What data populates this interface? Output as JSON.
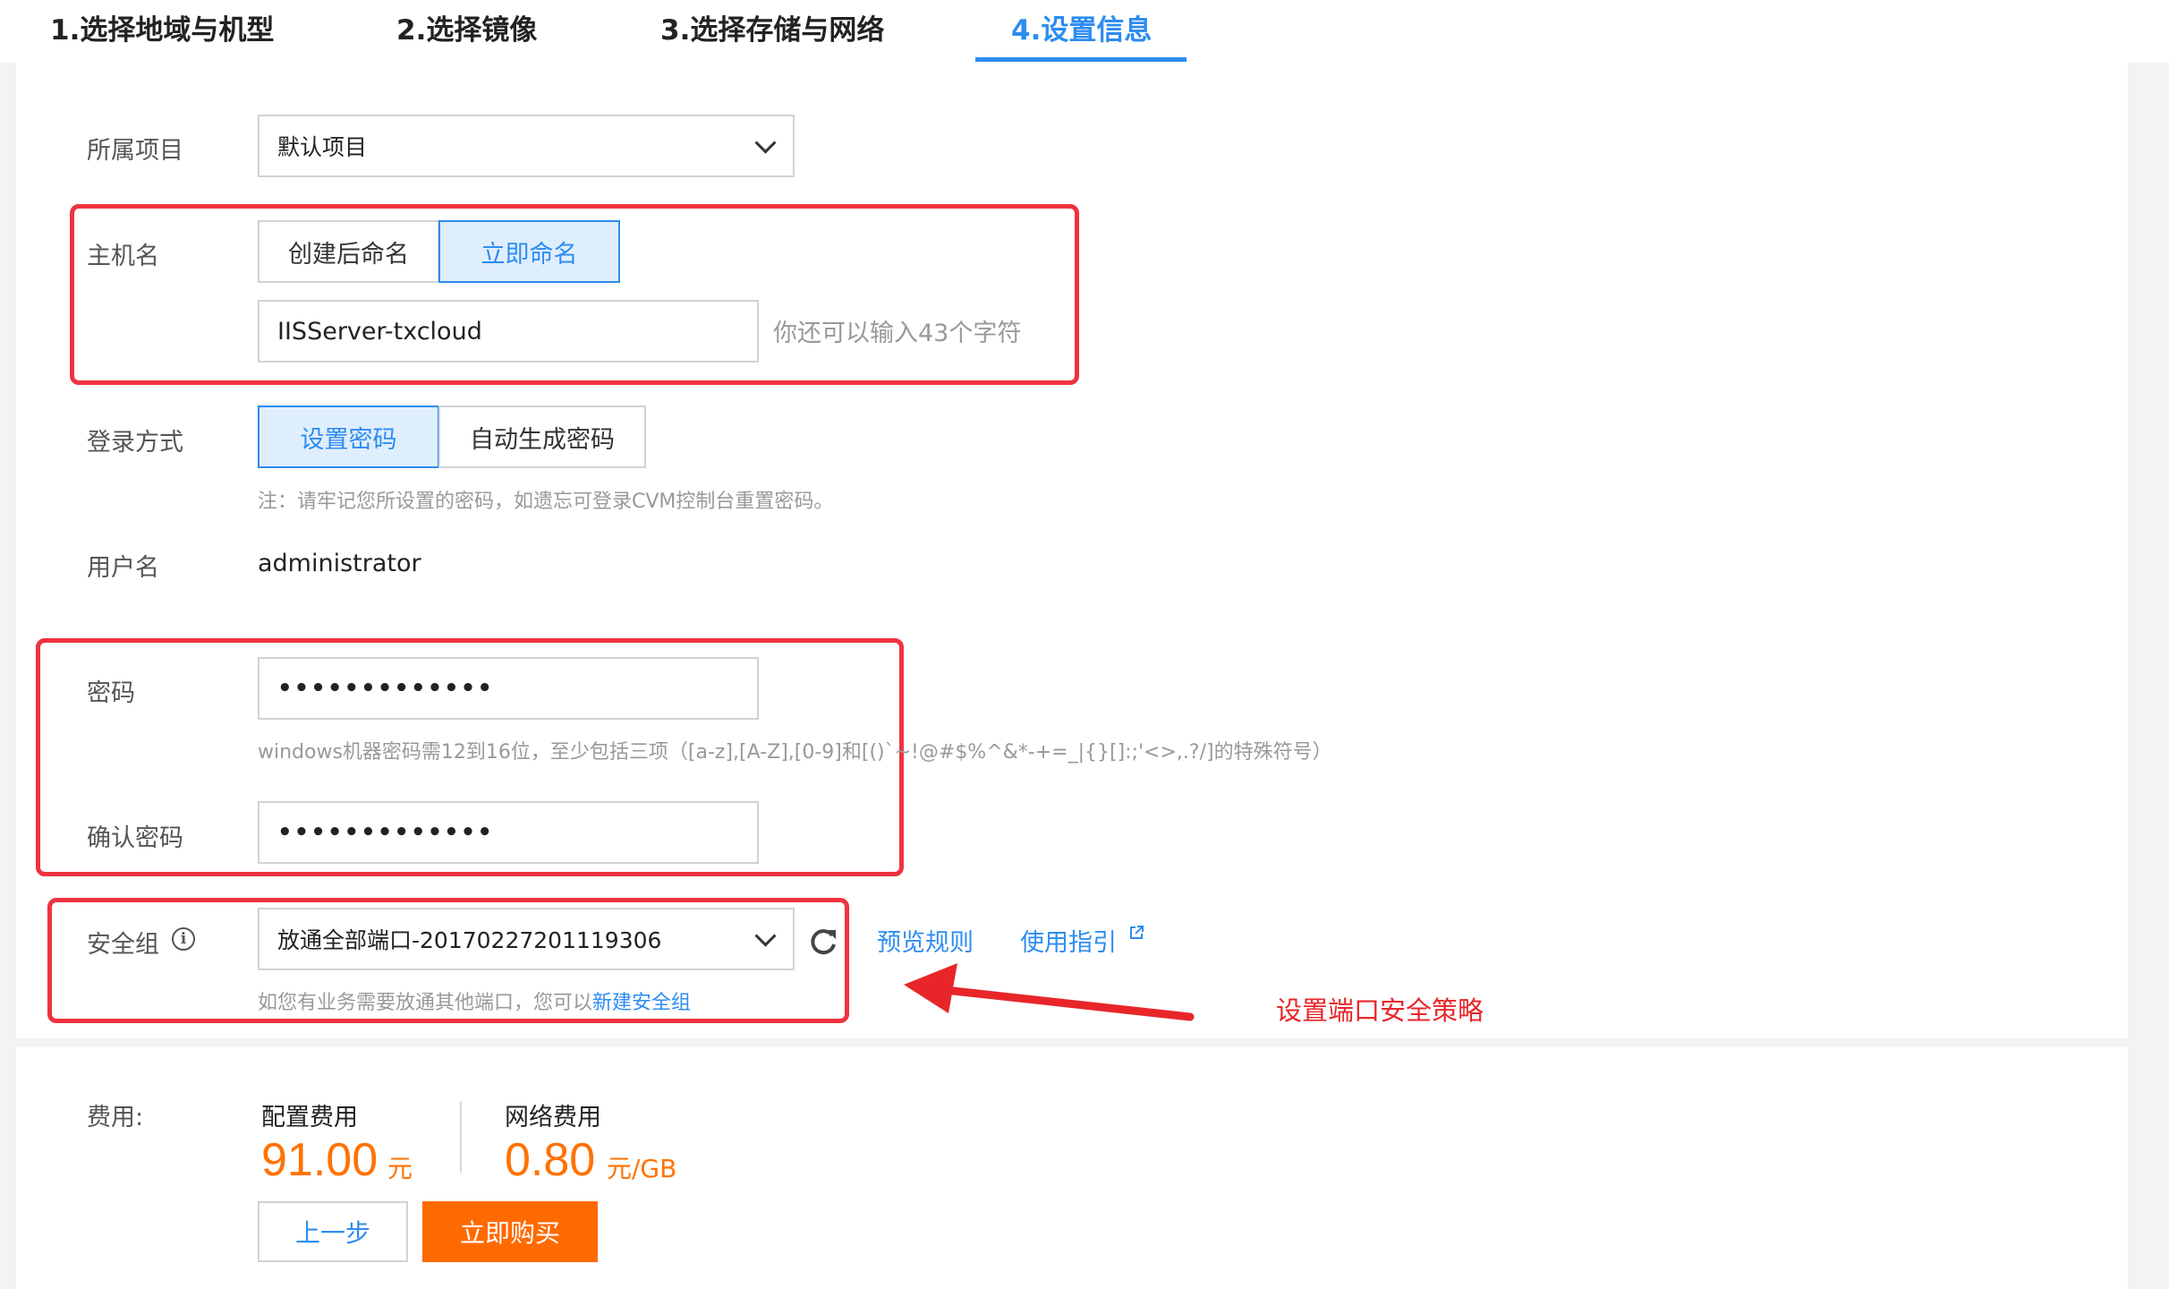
{
  "steps": [
    {
      "label": "1.选择地域与机型",
      "active": false
    },
    {
      "label": "2.选择镜像",
      "active": false
    },
    {
      "label": "3.选择存储与网络",
      "active": false
    },
    {
      "label": "4.设置信息",
      "active": true
    }
  ],
  "project": {
    "label": "所属项目",
    "value": "默认项目"
  },
  "hostname": {
    "label": "主机名",
    "options": [
      "创建后命名",
      "立即命名"
    ],
    "selected": "立即命名",
    "value": "IISServer-txcloud",
    "remaining": "你还可以输入43个字符"
  },
  "login": {
    "label": "登录方式",
    "options": [
      "设置密码",
      "自动生成密码"
    ],
    "selected": "设置密码",
    "note": "注：请牢记您所设置的密码，如遗忘可登录CVM控制台重置密码。"
  },
  "username": {
    "label": "用户名",
    "value": "administrator"
  },
  "password": {
    "label": "密码",
    "value": "•••••••••••••",
    "rule": "windows机器密码需12到16位，至少包括三项（[a-z],[A-Z],[0-9]和[()`~!@#$%^&*-+=_|{}[]:;'<>,.?/]的特殊符号）"
  },
  "confirm_password": {
    "label": "确认密码",
    "value": "•••••••••••••"
  },
  "security_group": {
    "label": "安全组",
    "value": "放通全部端口-20170227201119306",
    "preview_link": "预览规则",
    "guide_link": "使用指引",
    "hint_prefix": "如您有业务需要放通其他端口，您可以",
    "hint_link": "新建安全组"
  },
  "annotation": "设置端口安全策略",
  "annotation_color": "#e8262a",
  "fees": {
    "label": "费用:",
    "config_label": "配置费用",
    "config_price": "91.00",
    "config_unit": "元",
    "network_label": "网络费用",
    "network_price": "0.80",
    "network_unit": "元/GB"
  },
  "buttons": {
    "prev": "上一步",
    "buy": "立即购买"
  },
  "colors": {
    "accent": "#2d8cf0",
    "price": "#ff7200",
    "buy": "#ff6a00",
    "highlight_box": "#ef3340"
  },
  "icons": [
    "chevron-down-icon",
    "info-icon",
    "refresh-icon",
    "external-link-icon",
    "arrow-icon"
  ]
}
